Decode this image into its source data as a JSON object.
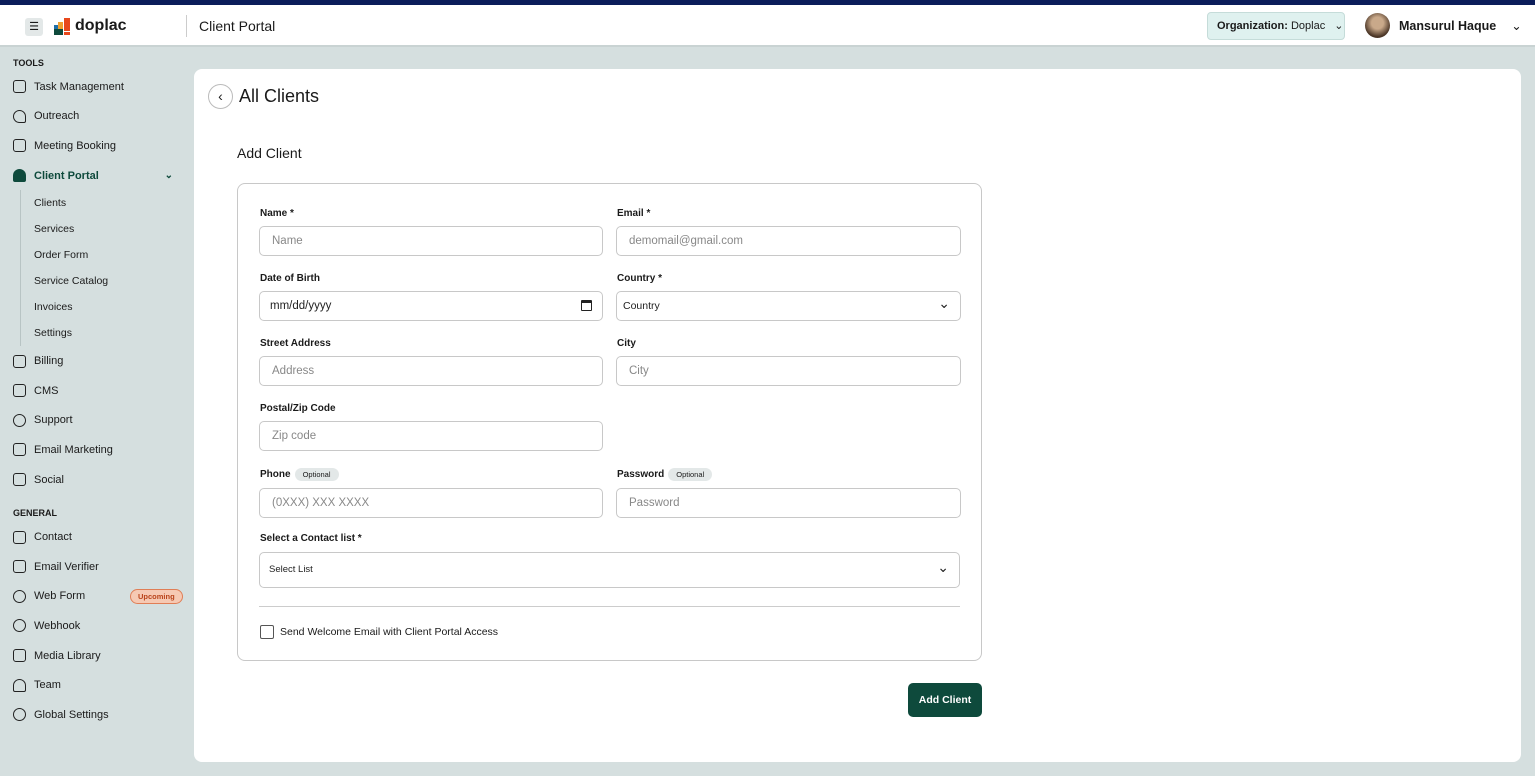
{
  "header": {
    "app_name": "doplac",
    "title": "Client Portal",
    "org_label": "Organization:",
    "org_value": "Doplac",
    "user_name": "Mansurul Haque"
  },
  "sidebar": {
    "tools_label": "TOOLS",
    "tools": [
      {
        "label": "Task Management"
      },
      {
        "label": "Outreach"
      },
      {
        "label": "Meeting Booking"
      },
      {
        "label": "Client Portal"
      }
    ],
    "client_portal_sub": [
      "Clients",
      "Services",
      "Order Form",
      "Service Catalog",
      "Invoices",
      "Settings"
    ],
    "tools2": [
      {
        "label": "Billing"
      },
      {
        "label": "CMS"
      },
      {
        "label": "Support"
      },
      {
        "label": "Email Marketing"
      },
      {
        "label": "Social"
      }
    ],
    "general_label": "GENERAL",
    "general": [
      {
        "label": "Contact"
      },
      {
        "label": "Email Verifier"
      },
      {
        "label": "Web Form",
        "badge": "Upcoming"
      },
      {
        "label": "Webhook"
      },
      {
        "label": "Media Library"
      },
      {
        "label": "Team"
      },
      {
        "label": "Global Settings"
      }
    ]
  },
  "page": {
    "title": "All Clients",
    "section": "Add Client"
  },
  "form": {
    "name_label": "Name *",
    "name_ph": "Name",
    "email_label": "Email *",
    "email_ph": "demomail@gmail.com",
    "dob_label": "Date of Birth",
    "dob_value": "mm/dd/yyyy",
    "country_label": "Country *",
    "country_value": "Country",
    "street_label": "Street Address",
    "street_ph": "Address",
    "city_label": "City",
    "city_ph": "City",
    "zip_label": "Postal/Zip Code",
    "zip_ph": "Zip code",
    "phone_label": "Phone",
    "phone_ph": "(0XXX) XXX XXXX",
    "password_label": "Password",
    "password_ph": "Password",
    "optional": "Optional",
    "contact_label": "Select a Contact list *",
    "contact_value": "Select List",
    "welcome_label": "Send Welcome Email with Client Portal Access",
    "submit": "Add Client"
  }
}
